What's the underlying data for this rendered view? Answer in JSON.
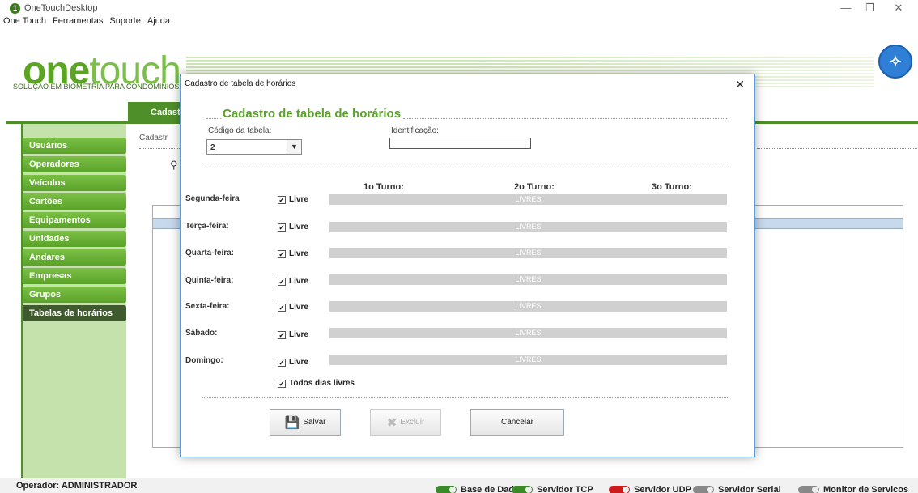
{
  "app": {
    "title": "OneTouchDesktop",
    "menu": [
      "One Touch",
      "Ferramentas",
      "Suporte",
      "Ajuda"
    ]
  },
  "header": {
    "logo_one": "one",
    "logo_touch": "touch",
    "subtitle": "SOLUÇÃO EM BIOMETRIA PARA CONDOMÍNIOS"
  },
  "sidebar": {
    "items": [
      {
        "label": "Usuários"
      },
      {
        "label": "Operadores"
      },
      {
        "label": "Veículos"
      },
      {
        "label": "Cartões"
      },
      {
        "label": "Equipamentos"
      },
      {
        "label": "Unidades"
      },
      {
        "label": "Andares"
      },
      {
        "label": "Empresas"
      },
      {
        "label": "Grupos"
      },
      {
        "label": "Tabelas de horários",
        "active": true
      }
    ]
  },
  "background": {
    "tab_label": "Cadast",
    "sub_label": "Cadastr"
  },
  "dialog": {
    "title": "Cadastro de tabela de horários",
    "heading": "Cadastro de tabela de horários",
    "codigo_label": "Código da tabela:",
    "codigo_value": "2",
    "ident_label": "Identificação:",
    "ident_value": "",
    "turnos": [
      "1o Turno:",
      "2o Turno:",
      "3o Turno:"
    ],
    "days": [
      {
        "name": "Segunda-feira",
        "livre": "Livre",
        "bar": "LIVRES",
        "checked": true
      },
      {
        "name": "Terça-feira:",
        "livre": "Livre",
        "bar": "LIVRES",
        "checked": true
      },
      {
        "name": "Quarta-feira:",
        "livre": "Livre",
        "bar": "LIVRES",
        "checked": true
      },
      {
        "name": "Quinta-feira:",
        "livre": "Livre",
        "bar": "LIVRES",
        "checked": true
      },
      {
        "name": "Sexta-feira:",
        "livre": "Livre",
        "bar": "LIVRES",
        "checked": true
      },
      {
        "name": "Sábado:",
        "livre": "Livre",
        "bar": "LIVRES",
        "checked": true
      },
      {
        "name": "Domingo:",
        "livre": "Livre",
        "bar": "LIVRES",
        "checked": true
      }
    ],
    "todos_label": "Todos dias livres",
    "buttons": {
      "save": "Salvar",
      "delete": "Excluir",
      "cancel": "Cancelar"
    }
  },
  "status": {
    "operator": "Operador: ADMINISTRADOR",
    "services": [
      {
        "label": "Base de Dados",
        "state": "green"
      },
      {
        "label": "Servidor TCP",
        "state": "green"
      },
      {
        "label": "Servidor UDP",
        "state": "red"
      },
      {
        "label": "Servidor Serial",
        "state": "gray"
      },
      {
        "label": "Monitor de Servicos",
        "state": "gray"
      }
    ]
  }
}
